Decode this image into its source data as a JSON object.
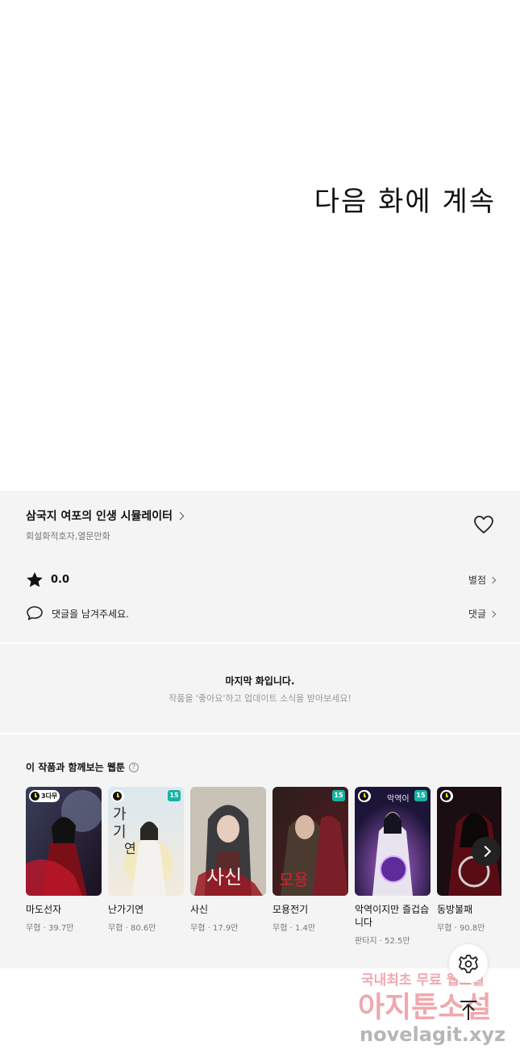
{
  "hero": {
    "text": "다음 화에 계속"
  },
  "series": {
    "title": "삼국지 여포의 인생 시뮬레이터",
    "authors": "회설화적호자,열문만화",
    "rating": "0.0",
    "rating_link": "별점",
    "comment_prompt": "댓글을 남겨주세요.",
    "comment_link": "댓글"
  },
  "last_episode": {
    "title": "마지막 화입니다.",
    "subtitle": "작품을 '좋아요'하고 업데이트 소식을 받아보세요!"
  },
  "recommend": {
    "title": "이 작품과 함께보는 웹툰",
    "items": [
      {
        "name": "마도선자",
        "genre": "무협",
        "views": "39.7만",
        "badge_wait": "3다무",
        "age": ""
      },
      {
        "name": "난가기연",
        "genre": "무협",
        "views": "80.6만",
        "badge_wait": "",
        "age": "15"
      },
      {
        "name": "사신",
        "genre": "무협",
        "views": "17.9만",
        "badge_wait": "",
        "age": ""
      },
      {
        "name": "모용전기",
        "genre": "무협",
        "views": "1.4만",
        "badge_wait": "",
        "age": "15"
      },
      {
        "name": "악역이지만 즐겁습니다",
        "genre": "판타지",
        "views": "52.5만",
        "badge_wait": "",
        "age": "15"
      },
      {
        "name": "동방불패",
        "genre": "무협",
        "views": "90.8만",
        "badge_wait": "",
        "age": ""
      }
    ]
  },
  "watermark": {
    "line1": "국내최초 무료 웹소설",
    "line2": "아지툰소설",
    "line3": "novelagit.xyz"
  },
  "colors": {
    "background": "#f4f4f4",
    "age_badge": "#16b3a4",
    "watermark": "#e04050"
  }
}
